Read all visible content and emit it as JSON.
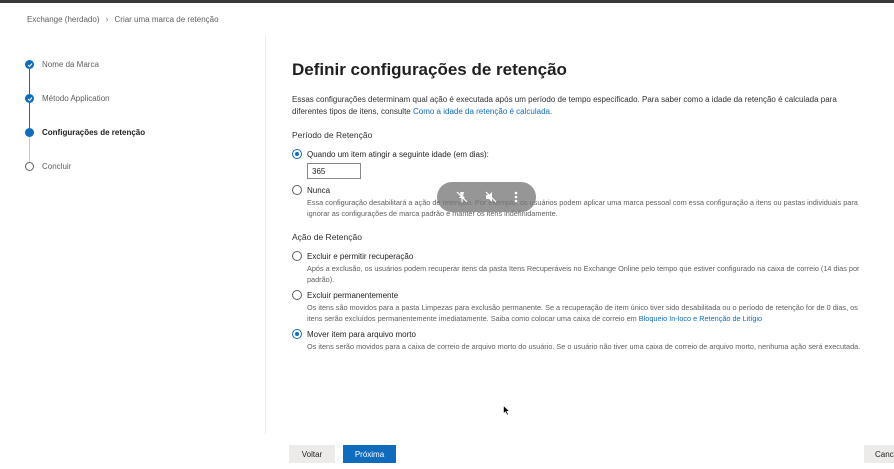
{
  "breadcrumb": {
    "root": "Exchange (herdado)",
    "current": "Criar uma marca de retenção"
  },
  "steps": [
    {
      "label": "Nome da Marca",
      "state": "done"
    },
    {
      "label": "Método Application",
      "state": "done"
    },
    {
      "label": "Configurações de retenção",
      "state": "current"
    },
    {
      "label": "Concluir",
      "state": "todo"
    }
  ],
  "main": {
    "title": "Definir configurações de retenção",
    "description": "Essas configurações determinam qual ação é executada após um período de tempo especificado. Para saber como a idade da retenção é calculada para diferentes tipos de itens, consulte",
    "description_link": "Como a idade da retenção é calculada.",
    "period_section": "Período de Retenção",
    "period_options": [
      {
        "label": "Quando um item atingir a seguinte idade (em dias):",
        "checked": true
      },
      {
        "label": "Nunca",
        "checked": false,
        "description": "Essa configuração desabilitará a ação de retenção. Por exemplo, os usuários podem aplicar uma marca pessoal com essa configuração a itens ou pastas individuais para ignorar as configurações de marca padrão e manter os itens indefinidamente."
      }
    ],
    "days_value": "365",
    "action_section": "Ação de Retenção",
    "action_options": [
      {
        "label": "Excluir e permitir recuperação",
        "checked": false,
        "description": "Após a exclusão, os usuários podem recuperar itens da pasta Itens Recuperáveis no Exchange Online pelo tempo que estiver configurado na caixa de correio (14 dias por padrão)."
      },
      {
        "label": "Excluir permanentemente",
        "checked": false,
        "description": "Os itens são movidos para a pasta Limpezas para exclusão permanente. Se a recuperação de item único tiver sido desabilitada ou o período de retenção for de 0 dias, os itens serão excluídos permanentemente imediatamente. Saiba como colocar uma caixa de correio em",
        "link": "Bloqueio In-loco e Retenção de Litígio"
      },
      {
        "label": "Mover item para arquivo morto",
        "checked": true,
        "description": "Os itens serão movidos para a caixa de correio de arquivo morto do usuário. Se o usuário não tiver uma caixa de correio de arquivo morto, nenhuma ação será executada."
      }
    ]
  },
  "overlay": {
    "icons": [
      "unpin-icon",
      "mute-icon",
      "more-vertical-icon"
    ]
  },
  "footer": {
    "back": "Voltar",
    "next": "Próxima",
    "cancel": "Cancelar"
  },
  "colors": {
    "accent": "#0f6cbd",
    "text": "#323130",
    "muted": "#605e5c"
  }
}
